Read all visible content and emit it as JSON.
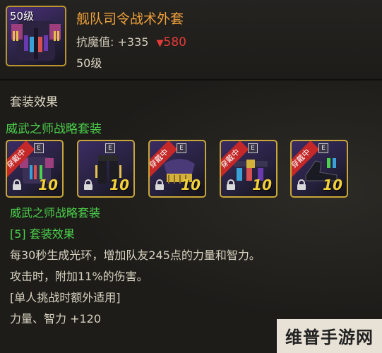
{
  "item": {
    "level_tag": "50级",
    "name": "舰队司令战术外套",
    "stat_label": "抗魔值:",
    "stat_value": "+335",
    "stat_delta_arrow": "▼",
    "stat_delta": "580",
    "level_text": "50级"
  },
  "set": {
    "section_title": "套装效果",
    "set_name": "威武之师战略套装",
    "slots": [
      {
        "ribbon": "穿戴中",
        "badge": "E",
        "number": "10",
        "icon": "coat-icon"
      },
      {
        "ribbon": "",
        "badge": "E",
        "number": "10",
        "icon": "pants-icon"
      },
      {
        "ribbon": "穿戴中",
        "badge": "E",
        "number": "10",
        "icon": "shoulder-icon"
      },
      {
        "ribbon": "穿戴中",
        "badge": "E",
        "number": "10",
        "icon": "belt-icon"
      },
      {
        "ribbon": "穿戴中",
        "badge": "E",
        "number": "10",
        "icon": "shoes-icon"
      }
    ]
  },
  "description": {
    "set_name": "威武之师战略套装",
    "tier": "[5] 套装效果",
    "line1": "每30秒生成光环，增加队友245点的力量和智力。",
    "line2": "攻击时，附加11%的伤害。",
    "line3": "[单人挑战时额外适用]",
    "line4": "力量、智力 +120"
  },
  "watermark": "维普手游网",
  "colors": {
    "item_name": "#f0a13a",
    "set_green": "#4bd14b",
    "stat_down": "#e63a3a",
    "frame_gold": "#c9a737",
    "slot_number": "#f3d23a"
  }
}
